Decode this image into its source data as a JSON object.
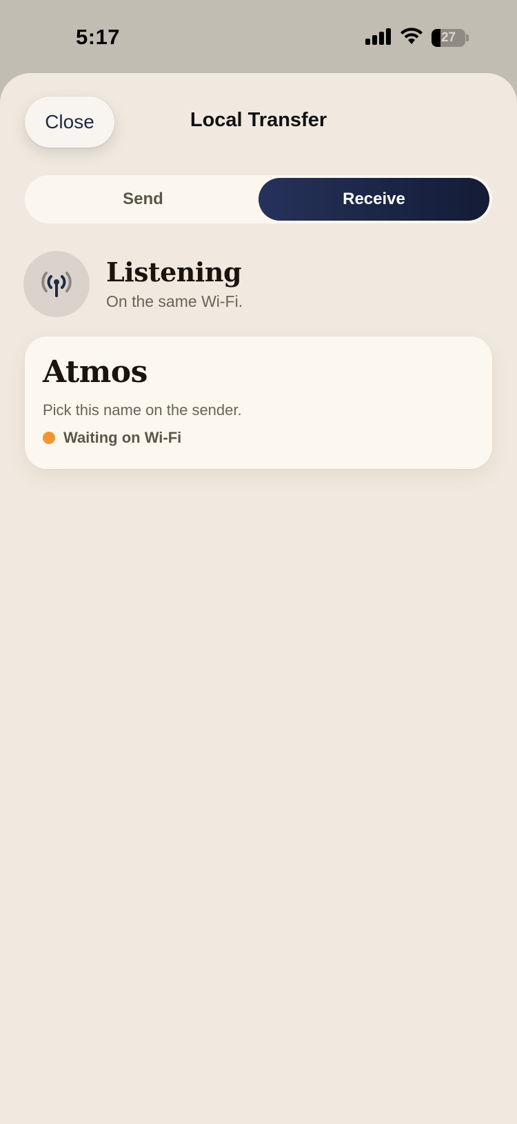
{
  "status_bar": {
    "time": "5:17",
    "battery_level": "27",
    "icons": [
      "signal-icon",
      "wifi-icon",
      "battery-icon"
    ]
  },
  "sheet": {
    "close_label": "Close",
    "title": "Local Transfer"
  },
  "segmented": {
    "send_label": "Send",
    "receive_label": "Receive",
    "selected": "Receive"
  },
  "listening": {
    "icon": "antenna-icon",
    "title": "Listening",
    "subtitle": "On the same Wi-Fi."
  },
  "device": {
    "name": "Atmos",
    "hint": "Pick this name on the sender.",
    "status": "Waiting on Wi-Fi",
    "status_color": "#ef9632"
  },
  "colors": {
    "accent": "#1e2a47",
    "sheet_background": "#f1e9df",
    "card_background": "#fcf8ef"
  }
}
